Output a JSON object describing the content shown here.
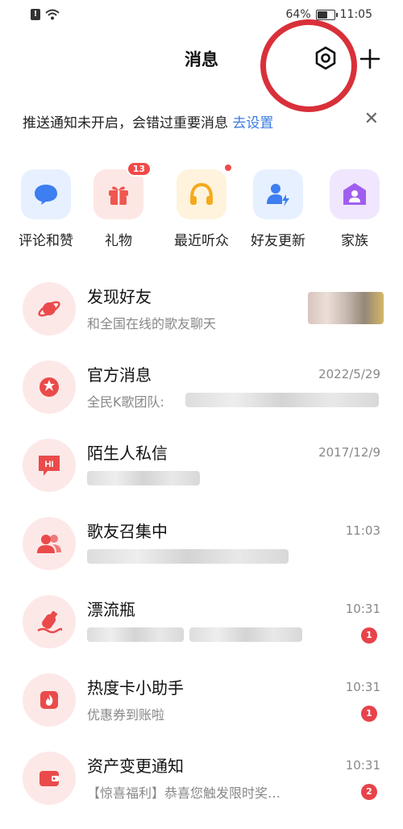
{
  "status_bar": {
    "battery": "64%",
    "time": "11:05",
    "battery_level": 0.64
  },
  "header": {
    "title": "消息"
  },
  "notice": {
    "text": "推送通知未开启，会错过重要消息 ",
    "link": "去设置"
  },
  "shortcuts": [
    {
      "label": "评论和赞",
      "icon": "comment-bubble-icon",
      "badge": "",
      "color": "#3d7ef0",
      "bg": "#e7f0ff"
    },
    {
      "label": "礼物",
      "icon": "gift-icon",
      "badge": "13",
      "color": "#f0564f",
      "bg": "#fde7e4"
    },
    {
      "label": "最近听众",
      "icon": "headphones-icon",
      "badge": "dot",
      "color": "#f5a91c",
      "bg": "#fff3dd"
    },
    {
      "label": "好友更新",
      "icon": "user-lightning-icon",
      "badge": "",
      "color": "#3d7ef0",
      "bg": "#e7f0ff"
    },
    {
      "label": "家族",
      "icon": "home-user-icon",
      "badge": "",
      "color": "#a05ef0",
      "bg": "#f0e6fd"
    }
  ],
  "messages": [
    {
      "title": "发现好友",
      "subtitle": "和全国在线的歌友聊天",
      "time": "",
      "badge": "",
      "icon": "planet-icon"
    },
    {
      "title": "官方消息",
      "subtitle": "全民K歌团队:",
      "time": "2022/5/29",
      "badge": "",
      "icon": "official-icon"
    },
    {
      "title": "陌生人私信",
      "subtitle": "",
      "time": "2017/12/9",
      "badge": "",
      "icon": "hi-bubble-icon"
    },
    {
      "title": "歌友召集中",
      "subtitle": "",
      "time": "11:03",
      "badge": "",
      "icon": "group-users-icon"
    },
    {
      "title": "漂流瓶",
      "subtitle": "",
      "time": "10:31",
      "badge": "1",
      "icon": "drift-bottle-icon"
    },
    {
      "title": "热度卡小助手",
      "subtitle": "优惠券到账啦",
      "time": "10:31",
      "badge": "1",
      "icon": "flame-card-icon"
    },
    {
      "title": "资产变更通知",
      "subtitle": "【惊喜福利】恭喜您触发限时奖…",
      "time": "10:31",
      "badge": "2",
      "icon": "wallet-icon"
    }
  ]
}
